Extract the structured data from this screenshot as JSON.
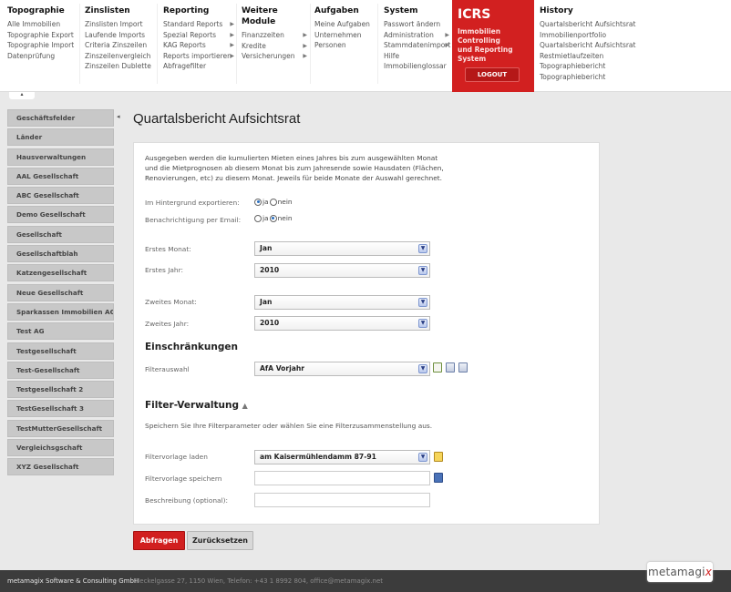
{
  "nav": {
    "topographie": {
      "title": "Topographie",
      "items": [
        "Alle Immobilien",
        "Topographie Export",
        "Topographie Import",
        "Datenprüfung"
      ]
    },
    "zinslisten": {
      "title": "Zinslisten",
      "items": [
        "Zinslisten Import",
        "Laufende Imports",
        "Criteria Zinszeilen",
        "Zinszeilenvergleich",
        "Zinszeilen Dublette"
      ]
    },
    "reporting": {
      "title": "Reporting",
      "items": [
        "Standard Reports",
        "Spezial Reports",
        "KAG Reports",
        "Reports importieren",
        "Abfragefilter"
      ]
    },
    "weitere": {
      "title": "Weitere Module",
      "items": [
        "Finanzzeiten",
        "Kredite",
        "Versicherungen"
      ]
    },
    "aufgaben": {
      "title": "Aufgaben",
      "items": [
        "Meine Aufgaben",
        "Unternehmen",
        "Personen"
      ]
    },
    "system": {
      "title": "System",
      "items": [
        "Passwort ändern",
        "Administration",
        "Stammdatenimport",
        "Hilfe",
        "Immobilienglossar"
      ]
    },
    "icrs": {
      "title": "ICRS",
      "subtitle_line1": "Immobilien Controlling",
      "subtitle_line2": "und Reporting System",
      "logout": "LOGOUT"
    },
    "history": {
      "title": "History",
      "items": [
        "Quartalsbericht Aufsichtsrat",
        "Immobilienportfolio",
        "Quartalsbericht Aufsichtsrat",
        "Restmietlaufzeiten",
        "Topographiebericht",
        "Topographiebericht"
      ]
    }
  },
  "sidebar": {
    "items": [
      "Geschäftsfelder",
      "Länder",
      "Hausverwaltungen",
      "AAL Gesellschaft",
      "ABC Gesellschaft",
      "Demo Gesellschaft",
      "Gesellschaft",
      "Gesellschaftblah",
      "Katzengesellschaft",
      "Neue Gesellschaft",
      "Sparkassen Immobilien AG",
      "Test AG",
      "Testgesellschaft",
      "Test-Gesellschaft",
      "Testgesellschaft 2",
      "TestGesellschaft 3",
      "TestMutterGesellschaft",
      "Vergleichsgschaft",
      "XYZ Gesellschaft"
    ]
  },
  "main": {
    "title": "Quartalsbericht Aufsichtsrat",
    "description": "Ausgegeben werden die kumulierten Mieten eines Jahres bis zum ausgewählten Monat und die Mietprognosen ab diesem Monat bis zum Jahresende sowie Hausdaten (Flächen, Renovierungen, etc) zu diesem Monat. Jeweils für beide Monate der Auswahl gerechnet.",
    "export_label": "Im Hintergrund exportieren:",
    "notify_label": "Benachrichtigung per Email:",
    "ja": "ja",
    "nein": "nein",
    "first_month_label": "Erstes Monat:",
    "first_month": "Jan",
    "first_year_label": "Erstes Jahr:",
    "first_year": "2010",
    "second_month_label": "Zweites Monat:",
    "second_month": "Jan",
    "second_year_label": "Zweites Jahr:",
    "second_year": "2010",
    "restrictions_heading": "Einschränkungen",
    "filter_select_label": "Filterauswahl",
    "filter_select": "AfA Vorjahr",
    "filter_admin_heading": "Filter-Verwaltung",
    "filter_admin_desc": "Speichern Sie Ihre Filterparameter oder wählen Sie eine Filterzusammenstellung aus.",
    "load_template_label": "Filtervorlage laden",
    "load_template_value": "am Kaisermühlendamm 87-91",
    "save_template_label": "Filtervorlage speichern",
    "description_label": "Beschreibung (optional):",
    "query_button": "Abfragen",
    "reset_button": "Zurücksetzen"
  },
  "footer": {
    "copyright": "metamagix Software & Consulting GmbH",
    "address": "Heckelgasse 27, 1150 Wien, Telefon: +43 1 8992 804, office@metamagix.net",
    "logo_main": "metamagi",
    "logo_x": "x"
  },
  "colors": {
    "accent": "#d22020",
    "sidebar": "#c8c8c8",
    "footer": "#3c3c3c"
  }
}
